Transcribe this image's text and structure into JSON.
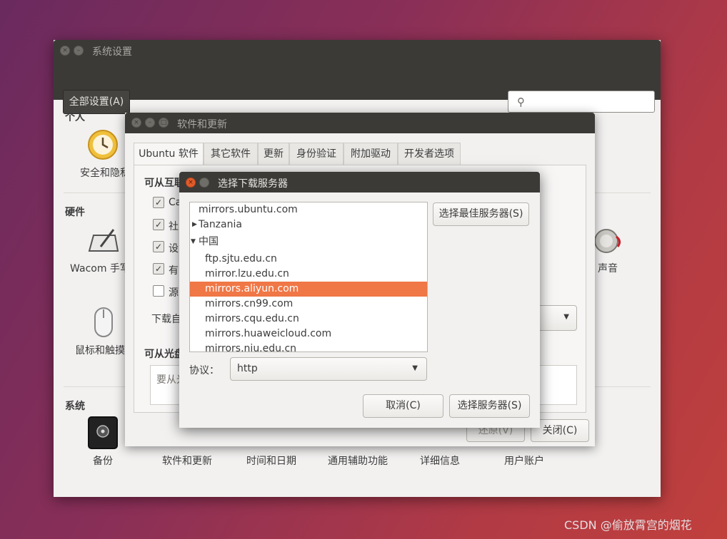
{
  "system_settings": {
    "title": "系统设置",
    "all_settings_button": "全部设置(A)",
    "search": {
      "icon": "search-icon",
      "value": ""
    },
    "sections": {
      "personal": "个人",
      "hardware": "硬件",
      "system": "系统"
    },
    "apps": {
      "security": "安全和隐私",
      "wacom": "Wacom 手写板",
      "mouse": "鼠标和触摸板",
      "sound": "声音",
      "backup": "备份",
      "software_updates": "软件和更新",
      "time_date": "时间和日期",
      "accessibility": "通用辅助功能",
      "details": "详细信息",
      "user_accounts": "用户账户"
    }
  },
  "software_updates": {
    "title": "软件和更新",
    "tabs": [
      "Ubuntu 软件",
      "其它软件",
      "更新",
      "身份验证",
      "附加驱动",
      "开发者选项"
    ],
    "active_tab": "Ubuntu 软件",
    "internet_section": "可从互联网下载",
    "checkboxes": [
      {
        "label": "Ca",
        "checked": true
      },
      {
        "label": "社",
        "checked": true
      },
      {
        "label": "设",
        "checked": true
      },
      {
        "label": "有",
        "checked": true
      },
      {
        "label": "源",
        "checked": false
      }
    ],
    "download_from_label": "下载自",
    "cdrom_section": "可从光盘",
    "cdrom_placeholder": "要从光",
    "revert_button": "还原(V)",
    "close_button": "关闭(C)"
  },
  "choose_server": {
    "title": "选择下载服务器",
    "best_server_button": "选择最佳服务器(S)",
    "servers": [
      {
        "label": "mirrors.ubuntu.com",
        "level": 0,
        "expander": ""
      },
      {
        "label": "Tanzania",
        "level": 0,
        "expander": "collapsed"
      },
      {
        "label": "中国",
        "level": 0,
        "expander": "expanded"
      },
      {
        "label": "ftp.sjtu.edu.cn",
        "level": 1,
        "expander": ""
      },
      {
        "label": "mirror.lzu.edu.cn",
        "level": 1,
        "expander": ""
      },
      {
        "label": "mirrors.aliyun.com",
        "level": 1,
        "expander": "",
        "selected": true
      },
      {
        "label": "mirrors.cn99.com",
        "level": 1,
        "expander": ""
      },
      {
        "label": "mirrors.cqu.edu.cn",
        "level": 1,
        "expander": ""
      },
      {
        "label": "mirrors.huaweicloud.com",
        "level": 1,
        "expander": ""
      },
      {
        "label": "mirrors.nju.edu.cn",
        "level": 1,
        "expander": ""
      }
    ],
    "protocol_label": "协议：",
    "protocol_value": "http",
    "cancel_button": "取消(C)",
    "choose_button": "选择服务器(S)"
  },
  "watermark": "CSDN @偷放霄宫的烟花",
  "colors": {
    "selection": "#f07746",
    "titlebar": "#3b3a37",
    "close_button": "#e05c2a"
  }
}
